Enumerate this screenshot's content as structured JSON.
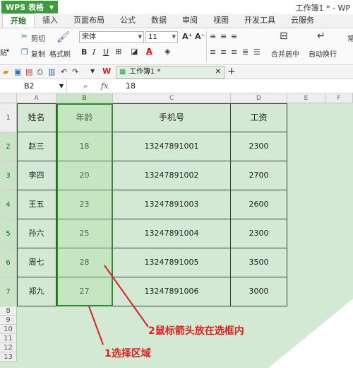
{
  "app": {
    "name": "WPS 表格",
    "doc_title": "工作簿1 * - WP"
  },
  "tabs": [
    "开始",
    "插入",
    "页面布局",
    "公式",
    "数据",
    "审阅",
    "视图",
    "开发工具",
    "云服务"
  ],
  "ribbon": {
    "cut": "剪切",
    "copy": "复制",
    "format_painter": "格式刷",
    "paste_partial": "贴",
    "font_name": "宋体",
    "font_size": "11",
    "merge_center": "合并居中",
    "wrap": "自动换行",
    "right_partial": "常"
  },
  "quick_access": {
    "doc_tab": "工作簿1 *"
  },
  "formula_bar": {
    "name_box": "B2",
    "fx": "fx",
    "value": "18"
  },
  "columns": [
    "A",
    "B",
    "C",
    "D",
    "E",
    "F"
  ],
  "rows_extra": [
    "8",
    "9",
    "10",
    "11",
    "12",
    "13"
  ],
  "table": {
    "headers": [
      "姓名",
      "年龄",
      "手机号",
      "工资"
    ],
    "rows": [
      [
        "赵三",
        "18",
        "13247891001",
        "2300"
      ],
      [
        "李四",
        "20",
        "13247891002",
        "2700"
      ],
      [
        "王五",
        "23",
        "13247891003",
        "2600"
      ],
      [
        "孙六",
        "25",
        "13247891004",
        "2300"
      ],
      [
        "周七",
        "28",
        "13247891005",
        "3500"
      ],
      [
        "郑九",
        "27",
        "13247891006",
        "3000"
      ]
    ]
  },
  "annotations": {
    "a1": "1选择区域",
    "a2": "2鼠标箭头放在选框内"
  },
  "colors": {
    "accent": "#3e9a3e",
    "annotation": "#dd2222",
    "grid_bg": "#d3e9d3"
  }
}
